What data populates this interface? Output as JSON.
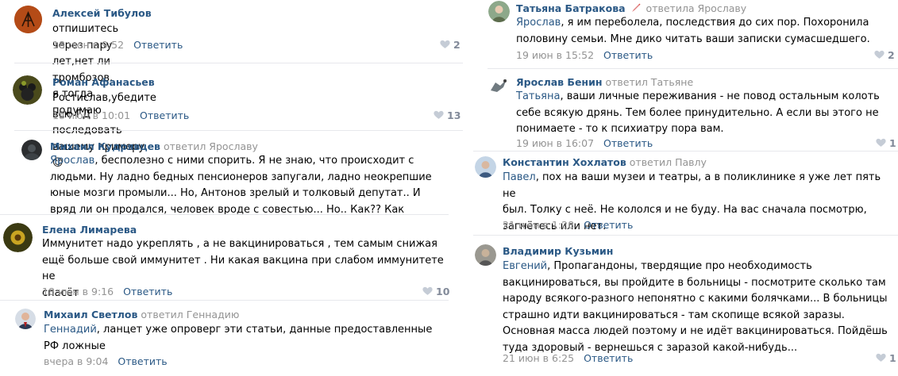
{
  "left": [
    {
      "id": "c1",
      "author": "Алексей Тибулов",
      "replied": "",
      "addressee": "",
      "lines": [
        "отпишитесь через пару лет,нет ли тромбозов. я тогда подумаю"
      ],
      "time": "18 июн в 9:52",
      "reply": "Ответить",
      "likes": "2"
    },
    {
      "id": "c2",
      "author": "Роман Афанасьев",
      "replied": "",
      "addressee": "",
      "lines": [
        "Ростислав,убедите всю ГД последовать вашему примеру.😊"
      ],
      "time": "18 июн в 10:01",
      "reply": "Ответить",
      "likes": "13"
    },
    {
      "id": "c3",
      "author": "Михаил Кудрявцев",
      "replied": "ответил Ярославу",
      "addressee": "Ярослав",
      "lines": [
        ", бесполезно с ними спорить. Я не знаю, что происходит с",
        "людьми. Ну ладно бедных пенсионеров запугали, ладно неокрепшие",
        "юные мозги промыли... Но, Антонов зрелый и толковый депутат.. И",
        "вряд ли он продался, человек вроде с совестью... Но.. Как?? Как"
      ],
      "time": "",
      "reply": "",
      "likes": ""
    },
    {
      "id": "c4",
      "author": "Елена Лимарева",
      "replied": "",
      "addressee": "",
      "lines": [
        "Иммунитет надо укреплять , а не вакцинироваться , тем самым снижая",
        "ещё больше свой иммунитет . Ни какая вакцина при слабом иммунитете не",
        "спасёт"
      ],
      "time": "18 июн в 9:16",
      "reply": "Ответить",
      "likes": "10"
    },
    {
      "id": "c5",
      "author": "Михаил Светлов",
      "replied": "ответил Геннадию",
      "addressee": "Геннадий",
      "lines": [
        ", ланцет уже опроверг эти статьи, данные предоставленные",
        "РФ ложные"
      ],
      "time": "вчера в 9:04",
      "reply": "Ответить",
      "likes": ""
    }
  ],
  "right": [
    {
      "id": "r1",
      "author": "Татьяна Батракова",
      "replied": "ответила Ярославу",
      "addressee": "Ярослав",
      "lines": [
        ", я им переболела, последствия до сих пор. Похоронила",
        "половину семьи. Мне дико читать ваши записки сумасшедшего."
      ],
      "time": "19 июн в 15:52",
      "reply": "Ответить",
      "likes": "2"
    },
    {
      "id": "r2",
      "author": "Ярослав Бенин",
      "replied": "ответил Татьяне",
      "addressee": "Татьяна",
      "lines": [
        ", ваши личные переживания - не повод остальным колоть",
        "себе всякую дрянь. Тем более принудительно. А если вы этого не",
        "понимаете - то к психиатру пора вам."
      ],
      "time": "19 июн в 16:07",
      "reply": "Ответить",
      "likes": "1"
    },
    {
      "id": "r3",
      "author": "Константин Хохлатов",
      "replied": "ответил Павлу",
      "addressee": "Павел",
      "lines": [
        ", пох на ваши музеи и театры, а в поликлинике я уже лет пять не",
        "был. Толку с неё. Не кололся и не буду. На вас сначала посмотрю,",
        "загнётесь или нет."
      ],
      "time": "21 июн в 1:28",
      "reply": "Ответить",
      "likes": ""
    },
    {
      "id": "r4",
      "author": "Владимир Кузьмин",
      "replied": "",
      "addressee": "Евгений",
      "lines": [
        ", Пропагандоны, твердящие про необходимость",
        "вакцинироваться, вы пройдите в больницы - посмотрите сколько там",
        "народу всякого-разного непонятно с какими болячками... В больницы",
        "страшно идти вакцинироваться - там скопище всякой заразы.",
        "Основная масса людей поэтому и не идёт вакцинироваться. Пойдёшь",
        "туда здоровый - вернешься с заразой какой-нибудь..."
      ],
      "time": "21 июн в 6:25",
      "reply": "Ответить",
      "likes": "1"
    }
  ],
  "colors": {
    "link": "#2a5885",
    "meta": "#939393",
    "separator": "#e7e8ec"
  }
}
